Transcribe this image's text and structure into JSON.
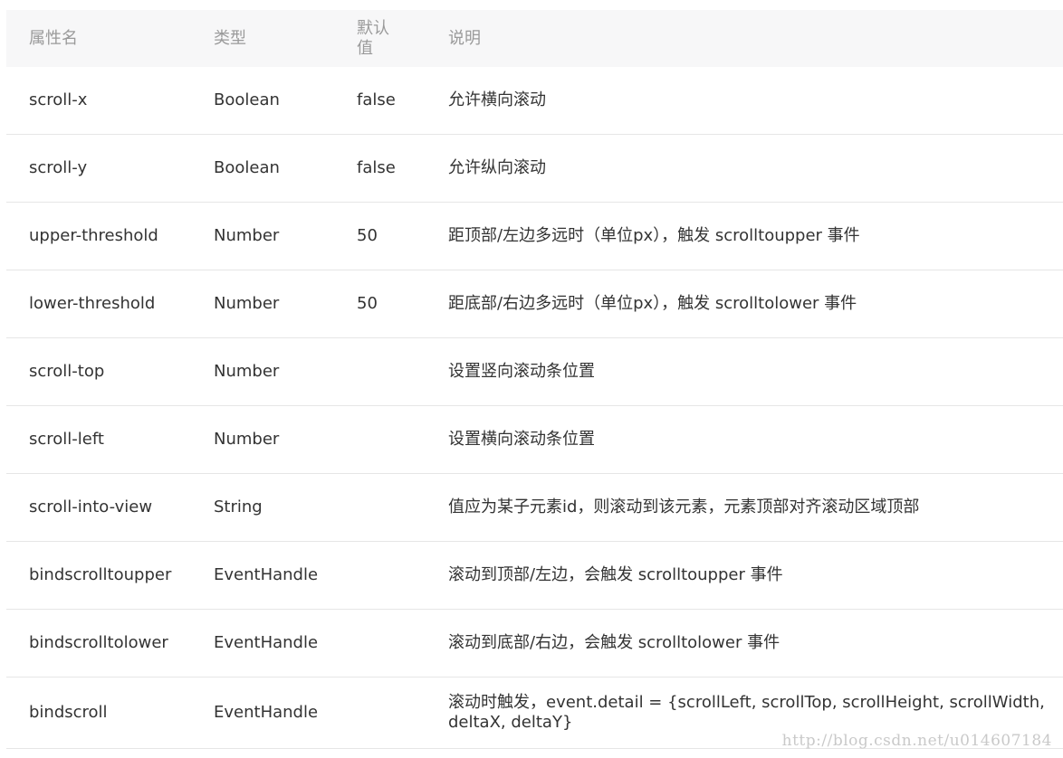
{
  "table": {
    "headers": [
      "属性名",
      "类型",
      "默认值",
      "说明"
    ],
    "rows": [
      {
        "name": "scroll-x",
        "type": "Boolean",
        "default": "false",
        "desc": "允许横向滚动"
      },
      {
        "name": "scroll-y",
        "type": "Boolean",
        "default": "false",
        "desc": "允许纵向滚动"
      },
      {
        "name": "upper-threshold",
        "type": "Number",
        "default": "50",
        "desc": "距顶部/左边多远时（单位px），触发 scrolltoupper 事件"
      },
      {
        "name": "lower-threshold",
        "type": "Number",
        "default": "50",
        "desc": "距底部/右边多远时（单位px），触发 scrolltolower 事件"
      },
      {
        "name": "scroll-top",
        "type": "Number",
        "default": "",
        "desc": "设置竖向滚动条位置"
      },
      {
        "name": "scroll-left",
        "type": "Number",
        "default": "",
        "desc": "设置横向滚动条位置"
      },
      {
        "name": "scroll-into-view",
        "type": "String",
        "default": "",
        "desc": "值应为某子元素id，则滚动到该元素，元素顶部对齐滚动区域顶部"
      },
      {
        "name": "bindscrolltoupper",
        "type": "EventHandle",
        "default": "",
        "desc": "滚动到顶部/左边，会触发 scrolltoupper 事件"
      },
      {
        "name": "bindscrolltolower",
        "type": "EventHandle",
        "default": "",
        "desc": "滚动到底部/右边，会触发 scrolltolower 事件"
      },
      {
        "name": "bindscroll",
        "type": "EventHandle",
        "default": "",
        "desc": "滚动时触发，event.detail = {scrollLeft, scrollTop, scrollHeight, scrollWidth, deltaX, deltaY}"
      }
    ]
  },
  "watermark": "http://blog.csdn.net/u014607184"
}
